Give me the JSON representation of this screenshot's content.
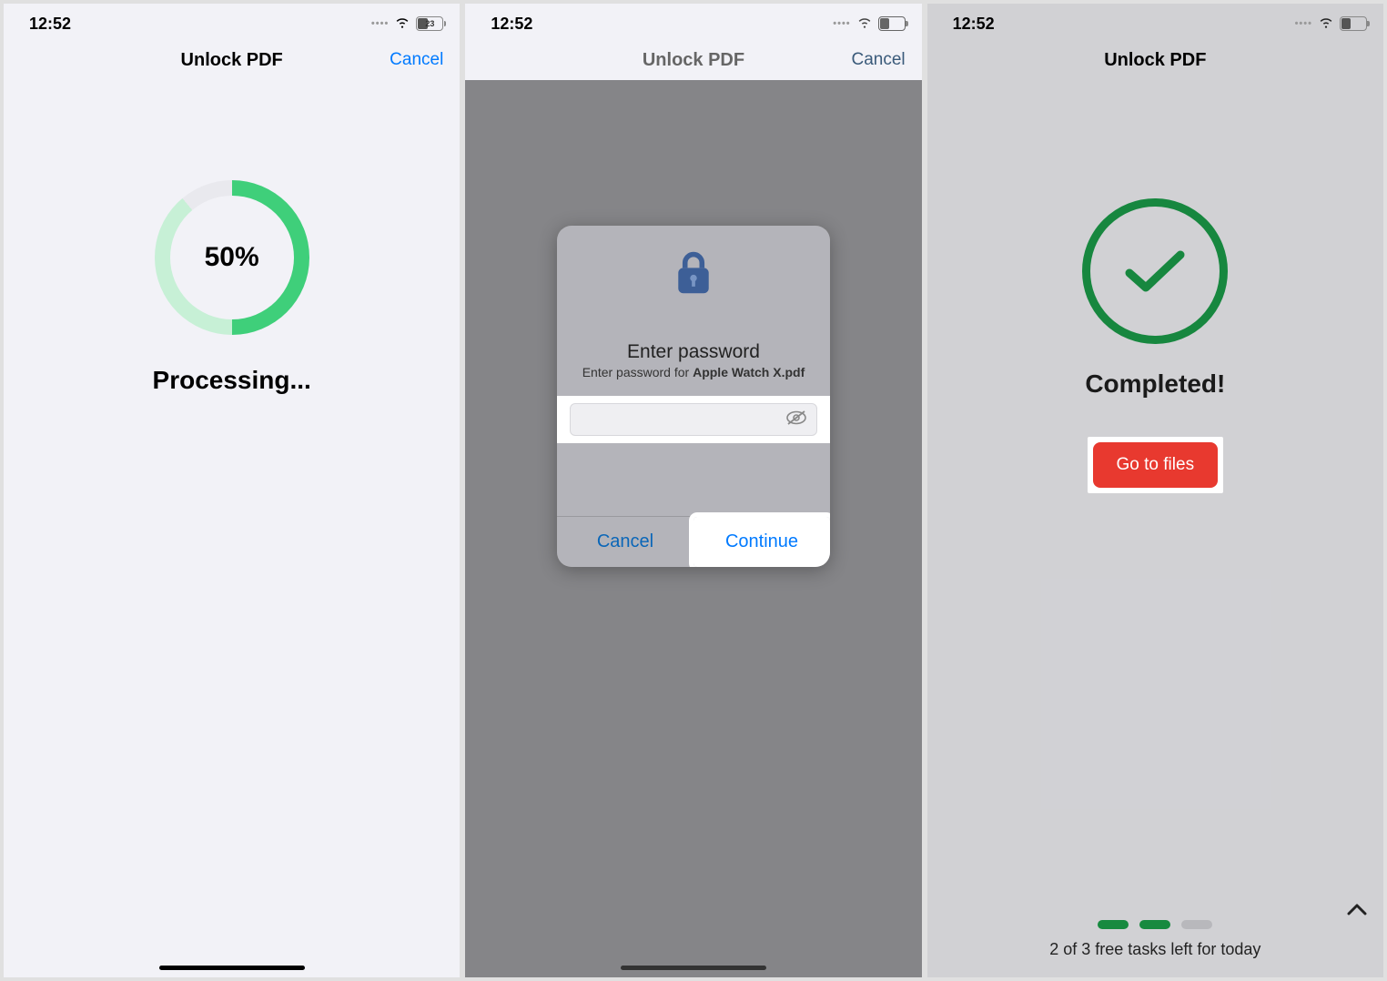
{
  "status": {
    "time": "12:52"
  },
  "header": {
    "title": "Unlock PDF",
    "cancel": "Cancel"
  },
  "screen1": {
    "progress_text": "50%",
    "status_label": "Processing..."
  },
  "screen2": {
    "modal_title": "Enter password",
    "modal_sub_prefix": "Enter password for ",
    "modal_sub_filename": "Apple Watch X.pdf",
    "cancel": "Cancel",
    "continue": "Continue"
  },
  "screen3": {
    "status_label": "Completed!",
    "button": "Go to files",
    "tasks_text": "2 of 3 free tasks left for today"
  }
}
